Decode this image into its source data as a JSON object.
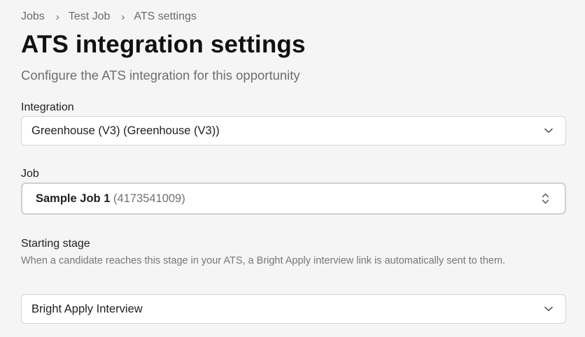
{
  "breadcrumb": {
    "items": [
      "Jobs",
      "Test Job",
      "ATS settings"
    ],
    "separator": "›"
  },
  "header": {
    "title": "ATS integration settings",
    "subtitle": "Configure the ATS integration for this opportunity"
  },
  "form": {
    "integration": {
      "label": "Integration",
      "value": "Greenhouse (V3) (Greenhouse (V3))",
      "icon": "chevron-down-icon"
    },
    "job": {
      "label": "Job",
      "value_name": "Sample Job 1",
      "value_id": "(4173541009)",
      "icon": "chevron-up-down-icon"
    },
    "starting_stage": {
      "label": "Starting stage",
      "help": "When a candidate reaches this stage in your ATS, a Bright Apply interview link is automatically sent to them.",
      "value": "Bright Apply Interview",
      "icon": "chevron-down-icon"
    }
  },
  "colors": {
    "background": "#f5f5f5",
    "field_background": "#ffffff",
    "border": "#d6d6d6",
    "muted_text": "#6e6e6e"
  }
}
